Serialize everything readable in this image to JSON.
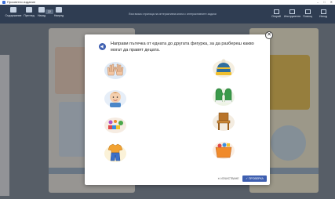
{
  "window": {
    "title": "Просветно издание",
    "controls": [
      "–",
      "□",
      "✕"
    ]
  },
  "toolbar": {
    "tools": [
      {
        "label": "Съдържание",
        "icon": "menu-icon"
      },
      {
        "label": "Преглед",
        "icon": "view-icon"
      },
      {
        "label": "Назад",
        "icon": "back-icon"
      }
    ],
    "page_value": "22",
    "next_label": "Напред",
    "message": "Във всяка страница на интерактивна книга с интерактивните задачи",
    "right_tools": [
      {
        "label": "Открий",
        "icon": "search-icon"
      },
      {
        "label": "Инструменти",
        "icon": "tools-icon"
      },
      {
        "label": "Помощ",
        "icon": "help-icon"
      },
      {
        "label": "Изход",
        "icon": "exit-icon"
      }
    ]
  },
  "modal": {
    "close_glyph": "✕",
    "instruction": "Направи пътечка от едната до другата фигурка, за да разбереш какво могат да правят децата.",
    "left_items": [
      "hands",
      "boy",
      "toys",
      "clothes"
    ],
    "right_items": [
      "winter-hat",
      "mittens",
      "chair",
      "toy-box"
    ],
    "clear_label": "✕ ИЗЧИСТВАНЕ",
    "check_label": "✓ ПРОВЕРКА"
  },
  "colors": {
    "toolbar": "#2f3d52",
    "check_button": "#3e5fb0"
  }
}
